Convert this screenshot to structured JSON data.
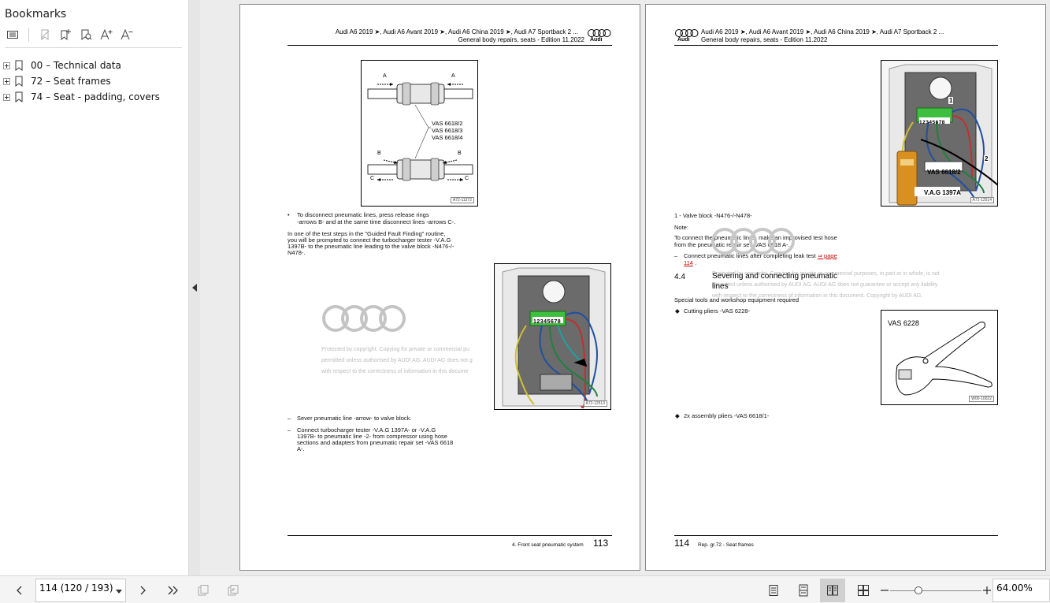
{
  "sidebar": {
    "title": "Bookmarks",
    "items": [
      {
        "label": "00 – Technical data"
      },
      {
        "label": "72 – Seat frames"
      },
      {
        "label": "74 – Seat - padding, covers"
      }
    ]
  },
  "page113": {
    "header_line1": "Audi A6 2019 ➤, Audi A6 Avant 2019 ➤, Audi A6 China 2019 ➤, Audi A7 Sportback 2 ...",
    "header_line2": "General body repairs, seats - Edition 11.2022",
    "logo_text": "Audi",
    "fig1": {
      "labels": [
        "A",
        "A",
        "B",
        "B",
        "C",
        "C"
      ],
      "callout1": "VAS 6618/2",
      "callout2": "VAS 6618/3",
      "callout3": "VAS 6618/4",
      "tag": "A72-11372"
    },
    "bullet1_line1": "To disconnect pneumatic lines, press release rings",
    "bullet1_line2": "-arrows B- and at the same time disconnect lines -arrows C-.",
    "para1_line1": "In one of the test steps in the \"Guided Fault Finding\" routine,",
    "para1_line2": "you will be prompted to connect the turbocharger tester -V.A.G",
    "para1_line3": "1397B- to the pneumatic line leading to the valve block -N476-/-",
    "para1_line4": "N478-.",
    "watermark_line1": "Protected by copyright. Copying for private or commercial pu",
    "watermark_line2": "permitted unless authorised by AUDI AG. AUDI AG does not g",
    "watermark_line3": "with respect to the correctness of information in this docume",
    "fig2": {
      "connector": "12345678",
      "tag": "A72-12513"
    },
    "dash1": "Sever pneumatic line -arrow- to valve block.",
    "dash2_line1": "Connect turbocharger tester -V.A.G 1397A- or -V.A.G",
    "dash2_line2": "1397B- to pneumatic line -2- from compressor using hose",
    "dash2_line3": "sections and adapters from pneumatic repair set -VAS 6618",
    "dash2_line4": "A-.",
    "footer_label": "4. Front seat pneumatic system",
    "footer_num": "113"
  },
  "page114": {
    "header_line1": "Audi A6 2019 ➤, Audi A6 Avant 2019 ➤, Audi A6 China 2019 ➤, Audi A7 Sportback 2 ...",
    "header_line2": "General body repairs, seats - Edition 11.2022",
    "logo_text": "Audi",
    "fig1": {
      "connector": "12345678",
      "label1": "1",
      "label2": "2",
      "tool1": "VAS 6618/2",
      "tool2": "V.A.G  1397A",
      "tag": "A72-12514"
    },
    "legend": "1 - Valve block -N476-/-N478-",
    "note": "Note:",
    "note_line1": "To connect the pneumatic lines, make an improvised test hose",
    "note_line2": "from the pneumatic repair set -VAS 6618 A-.",
    "dash1_text": "Connect pneumatic lines after completing leak test",
    "dash1_link1": "⇒ page",
    "dash1_link2": "114",
    "dash1_end": ".",
    "section_num": "4.4",
    "section_title_line1": "Severing and connecting pneumatic",
    "section_title_line2": "lines",
    "watermark_line1": "Protected by copyright. Copying for private or commercial purposes, in part or in whole, is not",
    "watermark_line2": "permitted unless authorised by AUDI AG. AUDI AG does not guarantee or accept any liability",
    "watermark_line3": "with respect to the correctness of information in this document. Copyright by AUDI AG.",
    "special_tools": "Special tools and workshop equipment required",
    "item1": "Cutting pliers -VAS 6228-",
    "fig2": {
      "label": "VAS 6228",
      "tag": "W00-10022"
    },
    "item2": "2x assembly pliers -VAS 6618/1-",
    "footer_num": "114",
    "footer_label": "Rep. gr.72 - Seat frames"
  },
  "toolbar": {
    "page_field": "114 (120 / 193)",
    "zoom_field": "64.00%",
    "zoom_fraction": 0.31
  }
}
